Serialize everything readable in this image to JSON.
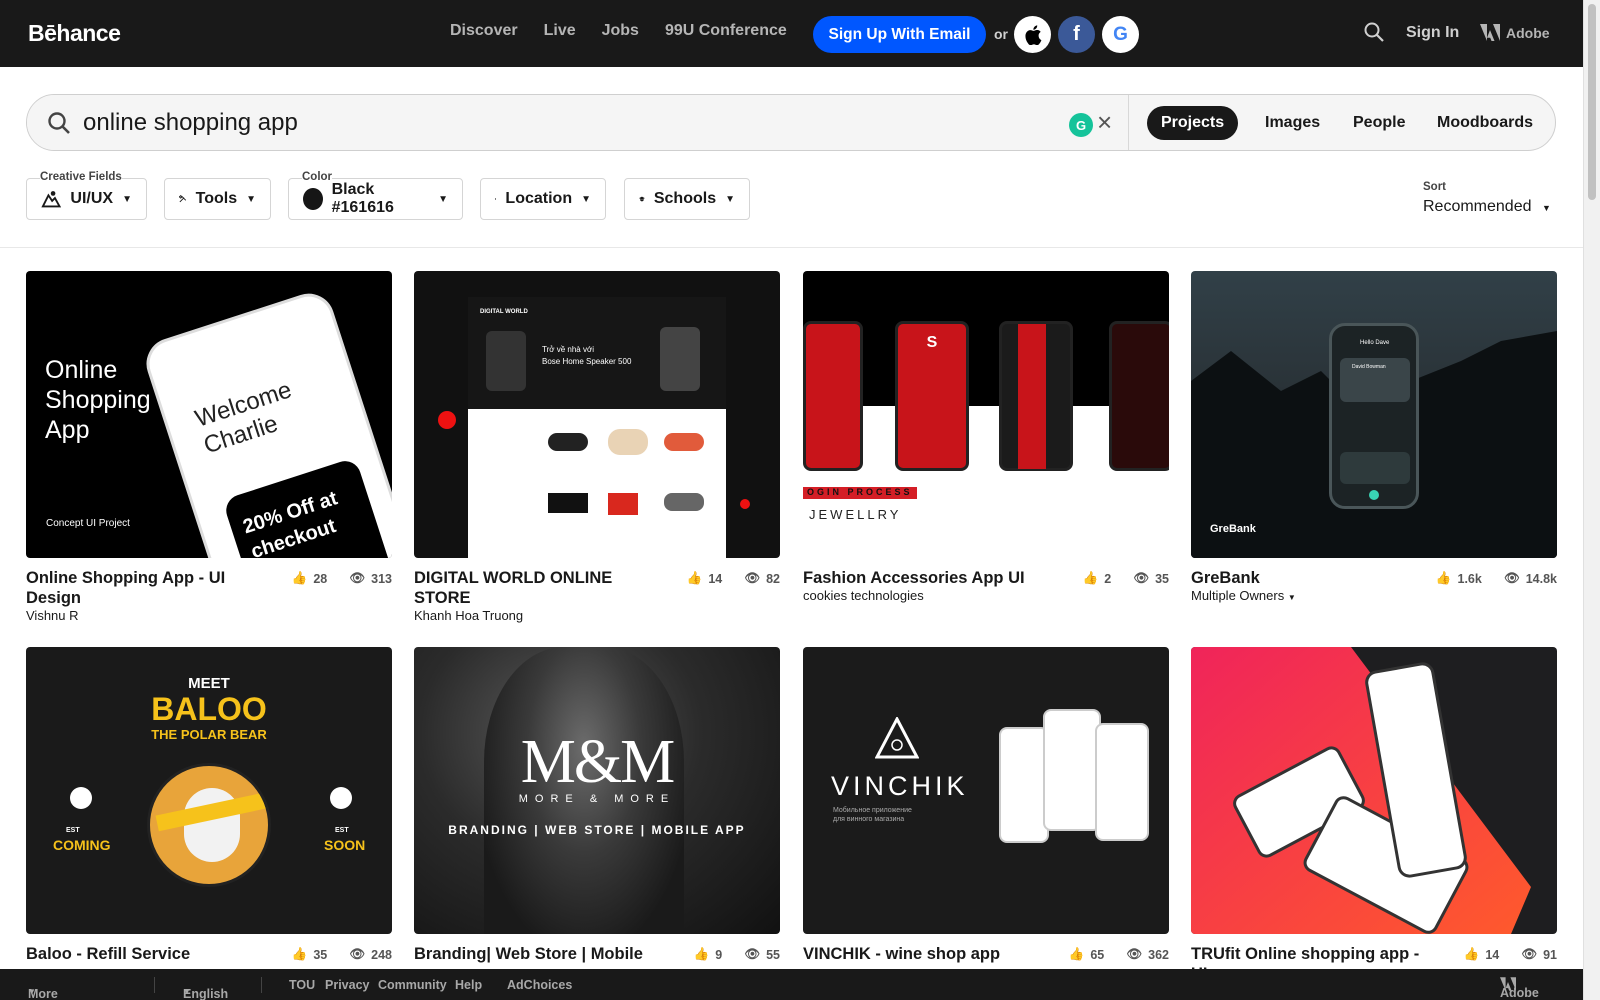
{
  "header": {
    "logo": "Bēhance",
    "nav": [
      "Discover",
      "Live",
      "Jobs",
      "99U Conference"
    ],
    "signup": "Sign Up With Email",
    "or": "or",
    "signin": "Sign In",
    "adobe": "Adobe"
  },
  "search": {
    "query": "online shopping app",
    "tabs": [
      "Projects",
      "Images",
      "People",
      "Moodboards"
    ],
    "active_tab": "Projects"
  },
  "filters": {
    "creative_fields_label": "Creative Fields",
    "creative_fields": "UI/UX",
    "tools": "Tools",
    "color_label": "Color",
    "color": "Black #161616",
    "location": "Location",
    "schools": "Schools",
    "sort_label": "Sort",
    "sort": "Recommended"
  },
  "projects": [
    {
      "title": "Online Shopping App - UI Design",
      "owner": "Vishnu R",
      "likes": "28",
      "views": "313",
      "art": {
        "h1": "Online",
        "h2": "Shopping",
        "h3": "App",
        "welcome": "Welcome",
        "name": "Charlie",
        "promo1": "20% Off at",
        "promo2": "checkout",
        "sub": "Concept UI Project"
      }
    },
    {
      "title": "DIGITAL WORLD ONLINE STORE",
      "owner": "Khanh Hoa Truong",
      "likes": "14",
      "views": "82",
      "art": {
        "brand": "DIGITAL WORLD",
        "hero1": "Trở về nhà với",
        "hero2": "Bose Home Speaker 500"
      }
    },
    {
      "title": "Fashion Accessories App UI",
      "owner": "cookies technologies",
      "likes": "2",
      "views": "35",
      "art": {
        "process": "OGIN PROCESS",
        "jewellry": "JEWELLRY",
        "s": "S"
      }
    },
    {
      "title": "GreBank",
      "owner": "Multiple Owners",
      "likes": "1.6k",
      "views": "14.8k",
      "art": {
        "brand": "GreBank",
        "hello": "Hello Dave",
        "user": "David Bowman"
      }
    },
    {
      "title": "Baloo - Refill Service",
      "owner": "",
      "likes": "35",
      "views": "248",
      "art": {
        "meet": "MEET",
        "baloo": "BALOO",
        "polar": "THE POLAR BEAR",
        "coming": "COMING",
        "soon": "SOON",
        "est": "EST"
      }
    },
    {
      "title": "Branding| Web Store | Mobile",
      "owner": "",
      "likes": "9",
      "views": "55",
      "art": {
        "mm": "M&M",
        "more": "MORE & MORE",
        "tag": "BRANDING | WEB STORE | MOBILE APP"
      }
    },
    {
      "title": "VINCHIK - wine shop app",
      "owner": "",
      "likes": "65",
      "views": "362",
      "art": {
        "brand": "VINCHIK",
        "sub1": "Мобильное приложение",
        "sub2": "для винного магазина"
      }
    },
    {
      "title": "TRUfit Online shopping app - UI",
      "owner": "",
      "likes": "14",
      "views": "91",
      "art": {}
    }
  ],
  "footer": {
    "more": "More Behance",
    "lang": "English",
    "links": [
      "TOU",
      "Privacy",
      "Community",
      "Help"
    ],
    "adchoices": "AdChoices",
    "adobe": "Adobe"
  }
}
